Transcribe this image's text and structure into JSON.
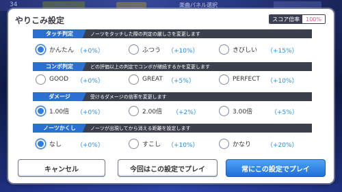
{
  "background": {
    "level_text": "34",
    "top_text": "楽曲パネル選択"
  },
  "dialog": {
    "title": "やりこみ設定",
    "score": {
      "label": "スコア倍率",
      "value": "100%"
    }
  },
  "sections": [
    {
      "label": "タッチ判定",
      "desc": "ノーツをタッチした際の判定の厳しさを変更します",
      "options": [
        {
          "label": "かんたん",
          "value": "（+0%）",
          "selected": true
        },
        {
          "label": "ふつう",
          "value": "（+10%）",
          "selected": false
        },
        {
          "label": "きびしい",
          "value": "（+15%）",
          "selected": false
        }
      ]
    },
    {
      "label": "コンボ判定",
      "desc": "どの評価以上の判定でコンボが継続するかを変更します",
      "options": [
        {
          "label": "GOOD",
          "value": "（+0%）",
          "selected": false
        },
        {
          "label": "GREAT",
          "value": "（+5%）",
          "selected": false
        },
        {
          "label": "PERFECT",
          "value": "（+10%）",
          "selected": false
        }
      ]
    },
    {
      "label": "ダメージ",
      "desc": "受けるダメージの倍率を変更します",
      "options": [
        {
          "label": "1.00倍",
          "value": "（+0%）",
          "selected": true
        },
        {
          "label": "2.00倍",
          "value": "（+2%）",
          "selected": false
        },
        {
          "label": "3.00倍",
          "value": "（+5%）",
          "selected": false
        }
      ]
    },
    {
      "label": "ノーツかくし",
      "desc": "ノーツが出現してから消える距離を設定します",
      "options": [
        {
          "label": "なし",
          "value": "（+0%）",
          "selected": true
        },
        {
          "label": "すこし",
          "value": "（+10%）",
          "selected": false
        },
        {
          "label": "かなり",
          "value": "（+20%）",
          "selected": false
        }
      ]
    }
  ],
  "buttons": {
    "cancel": "キャンセル",
    "once": "今回はこの設定でプレイ",
    "always": "常にこの設定でプレイ"
  },
  "colors": {
    "accent_blue": "#2a6fd1",
    "header_dark": "#3c3f4c",
    "value_blue": "#2a8fd6",
    "score_pink": "#e05a8a"
  }
}
